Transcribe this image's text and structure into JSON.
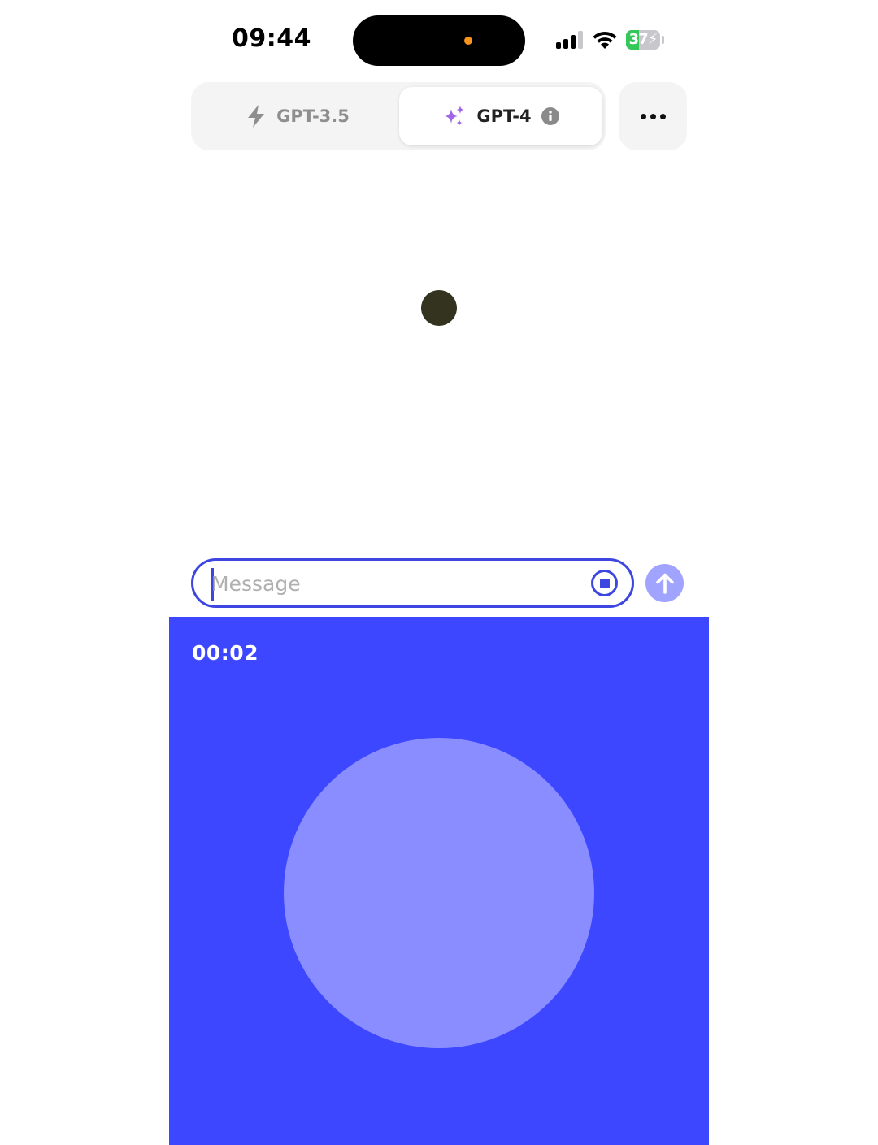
{
  "status_bar": {
    "time": "09:44",
    "battery_level": "37",
    "battery_percent": 37,
    "icons": [
      "cellular-signal-icon",
      "wifi-icon",
      "battery-charging-icon"
    ]
  },
  "model_selector": {
    "tabs": [
      {
        "label": "GPT-3.5",
        "icon": "lightning-bolt-icon",
        "selected": false
      },
      {
        "label": "GPT-4",
        "icon": "sparkles-icon",
        "info_icon": "info-icon",
        "selected": true
      }
    ],
    "more_icon": "ellipsis-icon"
  },
  "composer": {
    "placeholder": "Message",
    "value": "",
    "stop_icon": "stop-recording-icon",
    "send_icon": "send-arrow-icon"
  },
  "voice": {
    "timer": "00:02"
  },
  "colors": {
    "accent": "#3c47ff",
    "orb": "#898dff",
    "send_button": "#a0a4ff",
    "input_border": "#3d46e0",
    "loading_dot": "#33331f",
    "sparkles": "#a066e6",
    "island_indicator": "#f7931e",
    "battery_fill": "#34c759"
  }
}
